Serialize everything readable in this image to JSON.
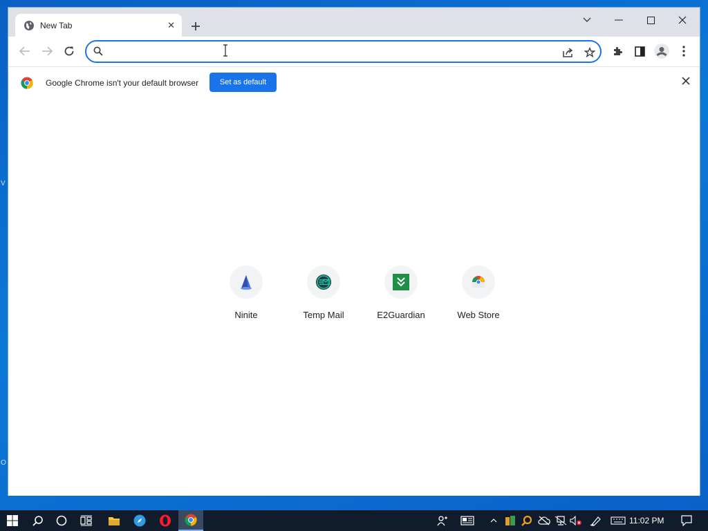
{
  "browser": {
    "tab_title": "New Tab",
    "omnibox_value": "",
    "omnibox_placeholder": ""
  },
  "infobar": {
    "message": "Google Chrome isn't your default browser",
    "button_label": "Set as default"
  },
  "shortcuts": [
    {
      "label": "Ninite",
      "icon": "ninite-icon"
    },
    {
      "label": "Temp Mail",
      "icon": "temp-mail-icon"
    },
    {
      "label": "E2Guardian",
      "icon": "e2guardian-icon"
    },
    {
      "label": "Web Store",
      "icon": "web-store-icon"
    }
  ],
  "taskbar": {
    "time": "11:02 PM"
  },
  "colors": {
    "accent": "#1a73e8",
    "tabstrip": "#dee1e6",
    "taskbar": "#101c2c"
  }
}
